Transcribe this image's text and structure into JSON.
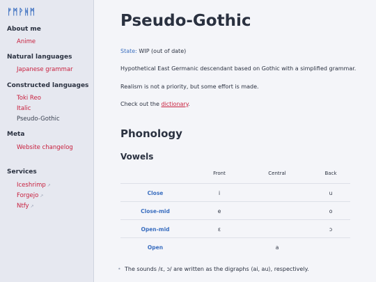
{
  "sidebar": {
    "logo": "ᚠᛗᚹᚻᛗ",
    "sections": [
      {
        "title": "About me",
        "items": [
          {
            "label": "Anime"
          }
        ]
      },
      {
        "title": "Natural languages",
        "items": [
          {
            "label": "Japanese grammar"
          }
        ]
      },
      {
        "title": "Constructed languages",
        "items": [
          {
            "label": "Toki Reo"
          },
          {
            "label": "Italic"
          },
          {
            "label": "Pseudo-Gothic"
          }
        ]
      },
      {
        "title": "Meta",
        "items": [
          {
            "label": "Website changelog"
          }
        ]
      },
      {
        "title": "Services",
        "items": [
          {
            "label": "Iceshrimp"
          },
          {
            "label": "Forgejo"
          },
          {
            "label": "Ntfy"
          }
        ]
      }
    ],
    "external_icon": "↗"
  },
  "main": {
    "title": "Pseudo-Gothic",
    "state_label": "State:",
    "state_value": "WIP (out of date)",
    "description": "Hypothetical East Germanic descendant based on Gothic with a simplified grammar.",
    "realism": "Realism is not a priority, but some effort is made.",
    "check_prefix": "Check out the",
    "dictionary_link": "dictionary",
    "check_suffix": ".",
    "phonology_heading": "Phonology",
    "vowels_heading": "Vowels",
    "vowel_table": {
      "columns": [
        "Front",
        "Central",
        "Back"
      ],
      "rows": [
        {
          "label": "Close",
          "front": "i",
          "central": "",
          "back": "u"
        },
        {
          "label": "Close-mid",
          "front": "e",
          "central": "",
          "back": "o"
        },
        {
          "label": "Open-mid",
          "front": "ɛ",
          "central": "",
          "back": "ɔ"
        },
        {
          "label": "Open",
          "front": "",
          "central": "a",
          "back": ""
        }
      ]
    },
    "bullet_1": "The sounds /ɛ, ɔ/ are written as the digraphs ⟨ai, au⟩, respectively."
  },
  "colors": {
    "accent": "#3b6fc0",
    "link": "#c81e3c",
    "sidebar_bg": "#e6e8f0",
    "page_bg": "#f4f5f9"
  }
}
